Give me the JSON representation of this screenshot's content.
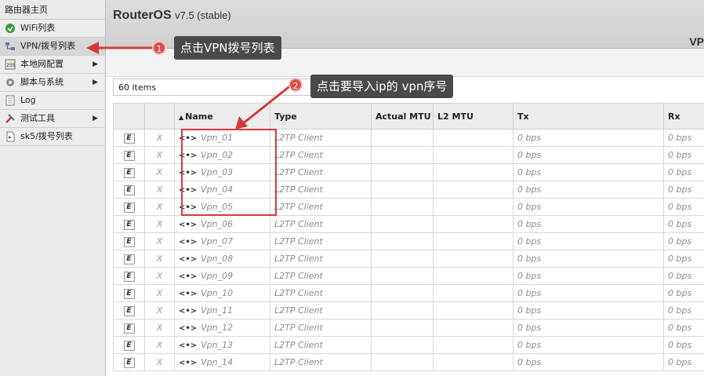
{
  "sidebar": {
    "title": "路由器主页",
    "items": [
      {
        "label": "WiFi列表",
        "icon": "wifi-icon",
        "has_arrow": false
      },
      {
        "label": "VPN/拨号列表",
        "icon": "vpn-icon",
        "has_arrow": false,
        "active": true
      },
      {
        "label": "本地网配置",
        "icon": "lan-icon",
        "has_arrow": true
      },
      {
        "label": "脚本与系统",
        "icon": "gear-icon",
        "has_arrow": true
      },
      {
        "label": "Log",
        "icon": "log-icon",
        "has_arrow": false
      },
      {
        "label": "测试工具",
        "icon": "tools-icon",
        "has_arrow": true
      },
      {
        "label": "sk5/拨号列表",
        "icon": "proxy-icon",
        "has_arrow": false
      }
    ]
  },
  "header": {
    "app_name": "RouterOS",
    "version": "v7.5 (stable)",
    "section": "VP"
  },
  "list": {
    "count_label": "60 items"
  },
  "table": {
    "columns": [
      "",
      "",
      "Name",
      "Type",
      "Actual MTU",
      "L2 MTU",
      "Tx",
      "Rx"
    ],
    "sort_indicator": "▲",
    "rows": [
      {
        "e": "E",
        "x": "X",
        "name": "Vpn_01",
        "type": "L2TP Client",
        "mtu": "",
        "l2mtu": "",
        "tx": "0 bps",
        "rx": "0 bps"
      },
      {
        "e": "E",
        "x": "X",
        "name": "Vpn_02",
        "type": "L2TP Client",
        "mtu": "",
        "l2mtu": "",
        "tx": "0 bps",
        "rx": "0 bps"
      },
      {
        "e": "E",
        "x": "X",
        "name": "Vpn_03",
        "type": "L2TP Client",
        "mtu": "",
        "l2mtu": "",
        "tx": "0 bps",
        "rx": "0 bps"
      },
      {
        "e": "E",
        "x": "X",
        "name": "Vpn_04",
        "type": "L2TP Client",
        "mtu": "",
        "l2mtu": "",
        "tx": "0 bps",
        "rx": "0 bps"
      },
      {
        "e": "E",
        "x": "X",
        "name": "Vpn_05",
        "type": "L2TP Client",
        "mtu": "",
        "l2mtu": "",
        "tx": "0 bps",
        "rx": "0 bps"
      },
      {
        "e": "E",
        "x": "X",
        "name": "Vpn_06",
        "type": "L2TP Client",
        "mtu": "",
        "l2mtu": "",
        "tx": "0 bps",
        "rx": "0 bps"
      },
      {
        "e": "E",
        "x": "X",
        "name": "Vpn_07",
        "type": "L2TP Client",
        "mtu": "",
        "l2mtu": "",
        "tx": "0 bps",
        "rx": "0 bps"
      },
      {
        "e": "E",
        "x": "X",
        "name": "Vpn_08",
        "type": "L2TP Client",
        "mtu": "",
        "l2mtu": "",
        "tx": "0 bps",
        "rx": "0 bps"
      },
      {
        "e": "E",
        "x": "X",
        "name": "Vpn_09",
        "type": "L2TP Client",
        "mtu": "",
        "l2mtu": "",
        "tx": "0 bps",
        "rx": "0 bps"
      },
      {
        "e": "E",
        "x": "X",
        "name": "Vpn_10",
        "type": "L2TP Client",
        "mtu": "",
        "l2mtu": "",
        "tx": "0 bps",
        "rx": "0 bps"
      },
      {
        "e": "E",
        "x": "X",
        "name": "Vpn_11",
        "type": "L2TP Client",
        "mtu": "",
        "l2mtu": "",
        "tx": "0 bps",
        "rx": "0 bps"
      },
      {
        "e": "E",
        "x": "X",
        "name": "Vpn_12",
        "type": "L2TP Client",
        "mtu": "",
        "l2mtu": "",
        "tx": "0 bps",
        "rx": "0 bps"
      },
      {
        "e": "E",
        "x": "X",
        "name": "Vpn_13",
        "type": "L2TP Client",
        "mtu": "",
        "l2mtu": "",
        "tx": "0 bps",
        "rx": "0 bps"
      },
      {
        "e": "E",
        "x": "X",
        "name": "Vpn_14",
        "type": "L2TP Client",
        "mtu": "",
        "l2mtu": "",
        "tx": "0 bps",
        "rx": "0 bps"
      }
    ]
  },
  "annotations": {
    "step1_number": "1",
    "step1_text": "点击VPN拨号列表",
    "step2_number": "2",
    "step2_text": "点击要导入ip的 vpn序号",
    "accent_color": "#d23b3b",
    "callout_color": "#4a4a4a"
  }
}
